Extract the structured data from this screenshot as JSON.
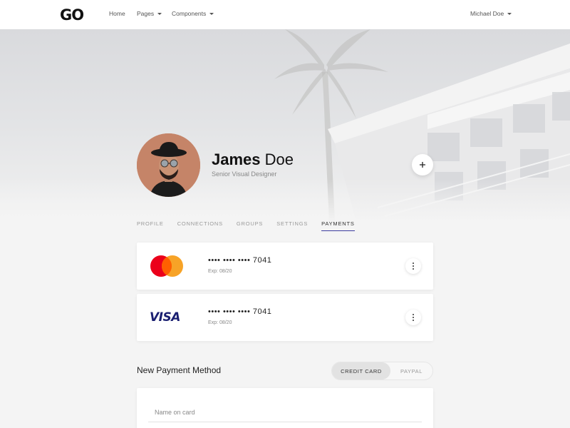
{
  "navbar": {
    "logo_text": "GO",
    "items": [
      {
        "label": "Home",
        "has_dropdown": false
      },
      {
        "label": "Pages",
        "has_dropdown": true
      },
      {
        "label": "Components",
        "has_dropdown": true
      }
    ],
    "user_menu": {
      "label": "Michael Doe",
      "has_dropdown": true
    }
  },
  "profile": {
    "first_name": "James",
    "last_name": "Doe",
    "job_title": "Senior Visual Designer",
    "add_button_icon": "plus-icon"
  },
  "tabs": [
    {
      "label": "PROFILE",
      "active": false
    },
    {
      "label": "CONNECTIONS",
      "active": false
    },
    {
      "label": "GROUPS",
      "active": false
    },
    {
      "label": "SETTINGS",
      "active": false
    },
    {
      "label": "PAYMENTS",
      "active": true
    }
  ],
  "cards": [
    {
      "brand": "mastercard",
      "number": "•••• •••• •••• 7041",
      "expiry": "Exp: 08/20",
      "menu_icon": "more-vertical-icon"
    },
    {
      "brand": "visa",
      "brand_text": "VISA",
      "number": "•••• •••• •••• 7041",
      "expiry": "Exp: 08/20",
      "menu_icon": "more-vertical-icon"
    }
  ],
  "new_payment": {
    "title": "New Payment Method",
    "toggle": [
      {
        "label": "CREDIT CARD",
        "active": true
      },
      {
        "label": "PAYPAL",
        "active": false
      }
    ],
    "form": {
      "name_placeholder": "Name on card",
      "name_value": ""
    }
  },
  "colors": {
    "accent": "#3d3d9e",
    "mastercard_red": "#eb001b",
    "mastercard_orange": "#f79e1b",
    "visa_blue": "#1a1f71",
    "avatar_bg": "#c98a6e"
  }
}
